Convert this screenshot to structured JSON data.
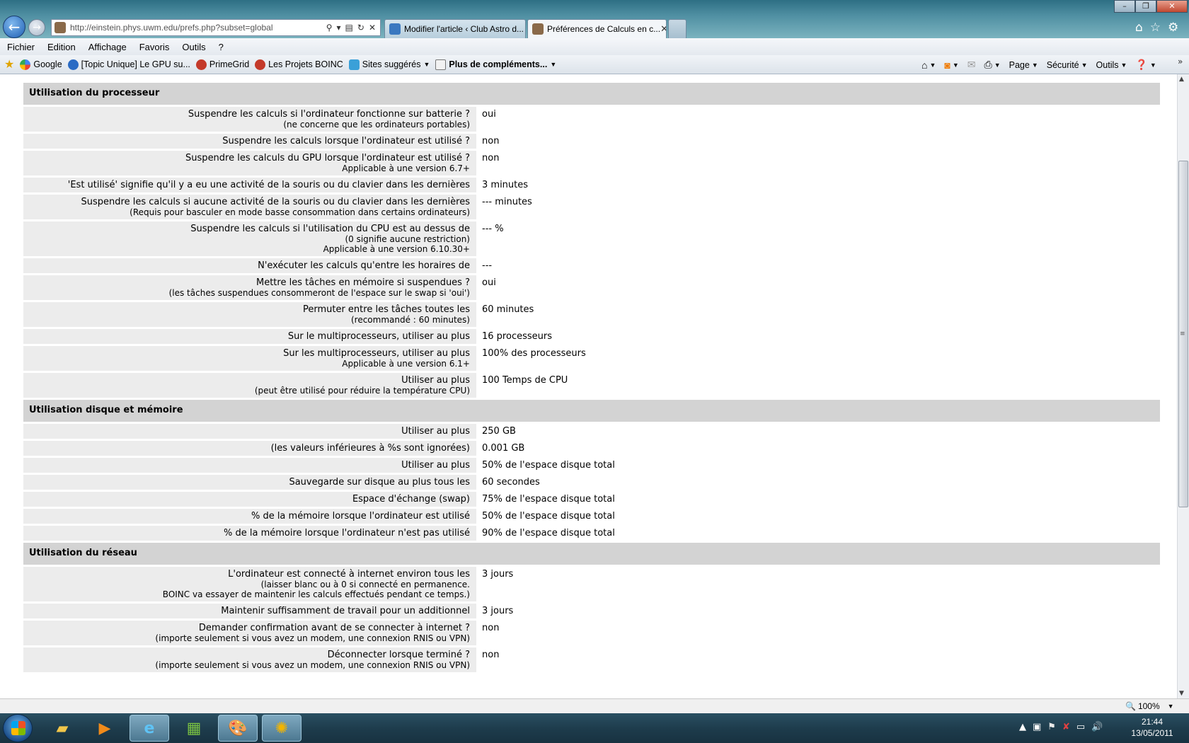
{
  "browser": {
    "url": "http://einstein.phys.uwm.edu/prefs.php?subset=global",
    "tabs": [
      {
        "label": "Modifier l'article ‹ Club Astro d..."
      },
      {
        "label": "Préférences de Calculs en c..."
      }
    ],
    "window_controls": {
      "minimize": "–",
      "restore": "❐",
      "close": "✕"
    }
  },
  "menu": [
    "Fichier",
    "Edition",
    "Affichage",
    "Favoris",
    "Outils",
    "?"
  ],
  "favorites": [
    {
      "label": "Google"
    },
    {
      "label": "[Topic Unique] Le GPU su..."
    },
    {
      "label": "PrimeGrid"
    },
    {
      "label": "Les Projets BOINC"
    },
    {
      "label": "Sites suggérés"
    },
    {
      "label": "Plus de compléments..."
    }
  ],
  "command_bar": {
    "page": "Page",
    "security": "Sécurité",
    "tools": "Outils"
  },
  "sections": [
    {
      "title": "Utilisation du processeur",
      "rows": [
        {
          "label": "Suspendre les calculs si l'ordinateur fonctionne sur batterie ?",
          "notes": [
            "(ne concerne que les ordinateurs portables)"
          ],
          "value": "oui"
        },
        {
          "label": "Suspendre les calculs lorsque l'ordinateur est utilisé ?",
          "notes": [],
          "value": "non"
        },
        {
          "label": "Suspendre les calculs du GPU lorsque l'ordinateur est utilisé ?",
          "notes": [
            "Applicable à une version 6.7+"
          ],
          "value": "non"
        },
        {
          "label": "'Est utilisé' signifie qu'il y a eu une activité de la souris ou du clavier dans les dernières",
          "notes": [],
          "value": "3 minutes"
        },
        {
          "label": "Suspendre les calculs si aucune activité de la souris ou du clavier dans les dernières",
          "notes": [
            "(Requis pour basculer en mode basse consommation dans certains ordinateurs)"
          ],
          "value": "--- minutes"
        },
        {
          "label": "Suspendre les calculs si l'utilisation du CPU est au dessus de",
          "notes": [
            "(0 signifie aucune restriction)",
            "Applicable à une version 6.10.30+"
          ],
          "value": "--- %"
        },
        {
          "label": "N'exécuter les calculs qu'entre les horaires de",
          "notes": [],
          "value": "---"
        },
        {
          "label": "Mettre les tâches en mémoire si suspendues ?",
          "notes": [
            "(les tâches suspendues consommeront de l'espace sur le swap si 'oui')"
          ],
          "value": "oui"
        },
        {
          "label": "Permuter entre les tâches toutes les",
          "notes": [
            "(recommandé : 60 minutes)"
          ],
          "value": "60 minutes"
        },
        {
          "label": "Sur le multiprocesseurs, utiliser au plus",
          "notes": [],
          "value": "16 processeurs"
        },
        {
          "label": "Sur les multiprocesseurs, utiliser au plus",
          "notes": [
            "Applicable à une version 6.1+"
          ],
          "value": "100% des processeurs"
        },
        {
          "label": "Utiliser au plus",
          "notes": [
            "(peut être utilisé pour réduire la température CPU)"
          ],
          "value": "100 Temps de CPU"
        }
      ]
    },
    {
      "title": "Utilisation disque et mémoire",
      "rows": [
        {
          "label": "Utiliser au plus",
          "notes": [],
          "value": "250 GB"
        },
        {
          "label": "(les valeurs inférieures à %s sont ignorées)",
          "notes": [],
          "value": "0.001 GB"
        },
        {
          "label": "Utiliser au plus",
          "notes": [],
          "value": "50% de l'espace disque total"
        },
        {
          "label": "Sauvegarde sur disque au plus tous les",
          "notes": [],
          "value": "60 secondes"
        },
        {
          "label": "Espace d'échange (swap)",
          "notes": [],
          "value": "75% de l'espace disque total"
        },
        {
          "label": "% de la mémoire lorsque l'ordinateur est utilisé",
          "notes": [],
          "value": "50% de l'espace disque total"
        },
        {
          "label": "% de la mémoire lorsque l'ordinateur n'est pas utilisé",
          "notes": [],
          "value": "90% de l'espace disque total"
        }
      ]
    },
    {
      "title": "Utilisation du réseau",
      "rows": [
        {
          "label": "L'ordinateur est connecté à internet environ tous les",
          "notes": [
            "(laisser blanc ou à 0 si connecté en permanence.",
            "BOINC va essayer de maintenir les calculs effectués pendant ce temps.)"
          ],
          "value": "3 jours"
        },
        {
          "label": "Maintenir suffisamment de travail pour un additionnel",
          "notes": [],
          "value": "3 jours"
        },
        {
          "label": "Demander confirmation avant de se connecter à internet ?",
          "notes": [
            "(importe seulement si vous avez un modem, une connexion RNIS ou VPN)"
          ],
          "value": "non"
        },
        {
          "label": "Déconnecter lorsque terminé ?",
          "notes": [
            "(importe seulement si vous avez un modem, une connexion RNIS ou VPN)"
          ],
          "value": "non"
        }
      ]
    }
  ],
  "status_bar": {
    "zoom": "100%"
  },
  "taskbar": {
    "time": "21:44",
    "date": "13/05/2011"
  },
  "colors": {
    "section_header": "#d3d3d3",
    "label_cell": "#ececec",
    "taskbar": "#1d3b4b"
  }
}
